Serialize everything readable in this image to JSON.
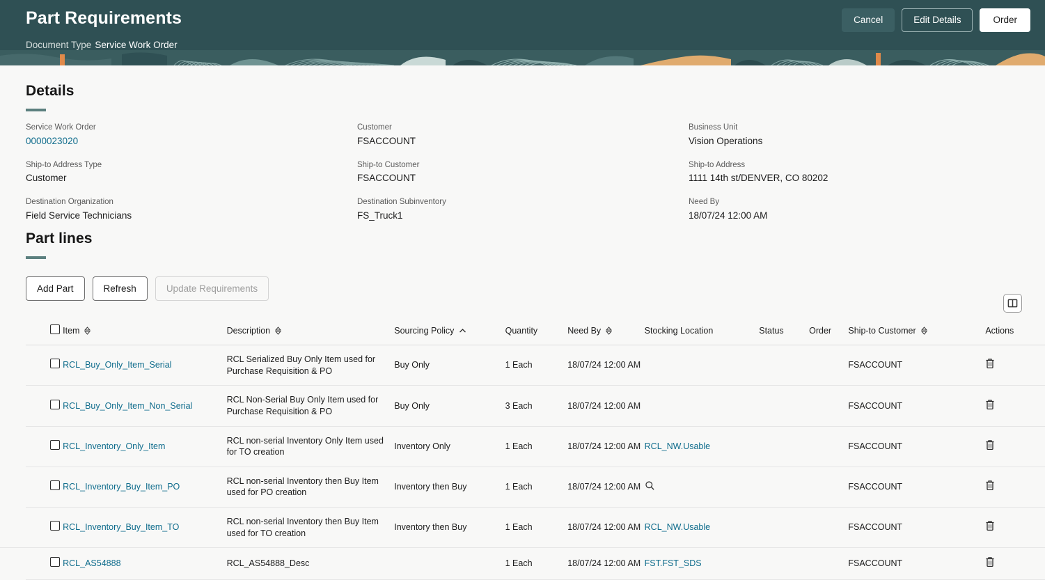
{
  "header": {
    "title": "Part Requirements",
    "document_type_label": "Document Type",
    "document_type_value": "Service Work Order",
    "cancel_label": "Cancel",
    "edit_details_label": "Edit Details",
    "order_label": "Order",
    "bg_color": "#2f5054"
  },
  "details": {
    "heading": "Details",
    "fields": [
      {
        "label": "Service Work Order",
        "value": "0000023020",
        "is_link": true
      },
      {
        "label": "Customer",
        "value": "FSACCOUNT",
        "is_link": false
      },
      {
        "label": "Business Unit",
        "value": "Vision Operations",
        "is_link": false
      },
      {
        "label": "Ship-to Address Type",
        "value": "Customer",
        "is_link": false
      },
      {
        "label": "Ship-to Customer",
        "value": "FSACCOUNT",
        "is_link": false
      },
      {
        "label": "Ship-to Address",
        "value": "1111 14th st/DENVER, CO 80202",
        "is_link": false
      },
      {
        "label": "Destination Organization",
        "value": "Field Service Technicians",
        "is_link": false
      },
      {
        "label": "Destination Subinventory",
        "value": "FS_Truck1",
        "is_link": false
      },
      {
        "label": "Need By",
        "value": "18/07/24 12:00 AM",
        "is_link": false
      }
    ]
  },
  "part_lines": {
    "heading": "Part lines",
    "toolbar": {
      "add_part_label": "Add Part",
      "refresh_label": "Refresh",
      "update_requirements_label": "Update Requirements",
      "update_requirements_disabled": true,
      "column_layout_icon": "columns-layout-icon"
    },
    "columns": [
      {
        "label": "",
        "sortable": false,
        "key": "select"
      },
      {
        "label": "Item",
        "sortable": true,
        "sorted": "none"
      },
      {
        "label": "Description",
        "sortable": true,
        "sorted": "none"
      },
      {
        "label": "Sourcing Policy",
        "sortable": true,
        "sorted": "asc"
      },
      {
        "label": "Quantity",
        "sortable": false
      },
      {
        "label": "Need By",
        "sortable": true,
        "sorted": "none"
      },
      {
        "label": "Stocking Location",
        "sortable": false
      },
      {
        "label": "Status",
        "sortable": false
      },
      {
        "label": "Order",
        "sortable": false
      },
      {
        "label": "Ship-to Customer",
        "sortable": true,
        "sorted": "none"
      },
      {
        "label": "Actions",
        "sortable": false
      }
    ],
    "rows": [
      {
        "selected": false,
        "item": "RCL_Buy_Only_Item_Serial",
        "description": "RCL Serialized Buy Only Item used for Purchase Requisition & PO",
        "sourcing_policy": "Buy Only",
        "quantity": "1 Each",
        "need_by": "18/07/24 12:00 AM",
        "stocking_location": "",
        "stocking_location_icon": "",
        "status": "",
        "order": "",
        "ship_to_customer": "FSACCOUNT",
        "action_icon": "trash-icon"
      },
      {
        "selected": false,
        "item": "RCL_Buy_Only_Item_Non_Serial",
        "description": "RCL Non-Serial Buy Only Item used for Purchase Requisition & PO",
        "sourcing_policy": "Buy Only",
        "quantity": "3 Each",
        "need_by": "18/07/24 12:00 AM",
        "stocking_location": "",
        "stocking_location_icon": "",
        "status": "",
        "order": "",
        "ship_to_customer": "FSACCOUNT",
        "action_icon": "trash-icon"
      },
      {
        "selected": false,
        "item": "RCL_Inventory_Only_Item",
        "description": "RCL non-serial Inventory Only Item used for TO creation",
        "sourcing_policy": "Inventory Only",
        "quantity": "1 Each",
        "need_by": "18/07/24 12:00 AM",
        "stocking_location": "RCL_NW.Usable",
        "stocking_location_icon": "",
        "status": "",
        "order": "",
        "ship_to_customer": "FSACCOUNT",
        "action_icon": "trash-icon"
      },
      {
        "selected": false,
        "item": "RCL_Inventory_Buy_Item_PO",
        "description": "RCL non-serial Inventory then Buy Item used for PO creation",
        "sourcing_policy": "Inventory then Buy",
        "quantity": "1 Each",
        "need_by": "18/07/24 12:00 AM",
        "stocking_location": "",
        "stocking_location_icon": "search-icon",
        "status": "",
        "order": "",
        "ship_to_customer": "FSACCOUNT",
        "action_icon": "trash-icon"
      },
      {
        "selected": false,
        "item": "RCL_Inventory_Buy_Item_TO",
        "description": "RCL non-serial Inventory then Buy Item used for TO creation",
        "sourcing_policy": "Inventory then Buy",
        "quantity": "1 Each",
        "need_by": "18/07/24 12:00 AM",
        "stocking_location": "RCL_NW.Usable",
        "stocking_location_icon": "",
        "status": "",
        "order": "",
        "ship_to_customer": "FSACCOUNT",
        "action_icon": "trash-icon"
      },
      {
        "selected": false,
        "item": "RCL_AS54888",
        "description": "RCL_AS54888_Desc",
        "sourcing_policy": "",
        "quantity": "1 Each",
        "need_by": "18/07/24 12:00 AM",
        "stocking_location": "FST.FST_SDS",
        "stocking_location_icon": "",
        "status": "",
        "order": "",
        "ship_to_customer": "FSACCOUNT",
        "action_icon": "trash-icon"
      }
    ]
  },
  "colors": {
    "header_bg": "#2f5054",
    "accent_rule": "#5c807f",
    "link": "#0f6c8c",
    "page_bg": "#f8f8f7"
  }
}
